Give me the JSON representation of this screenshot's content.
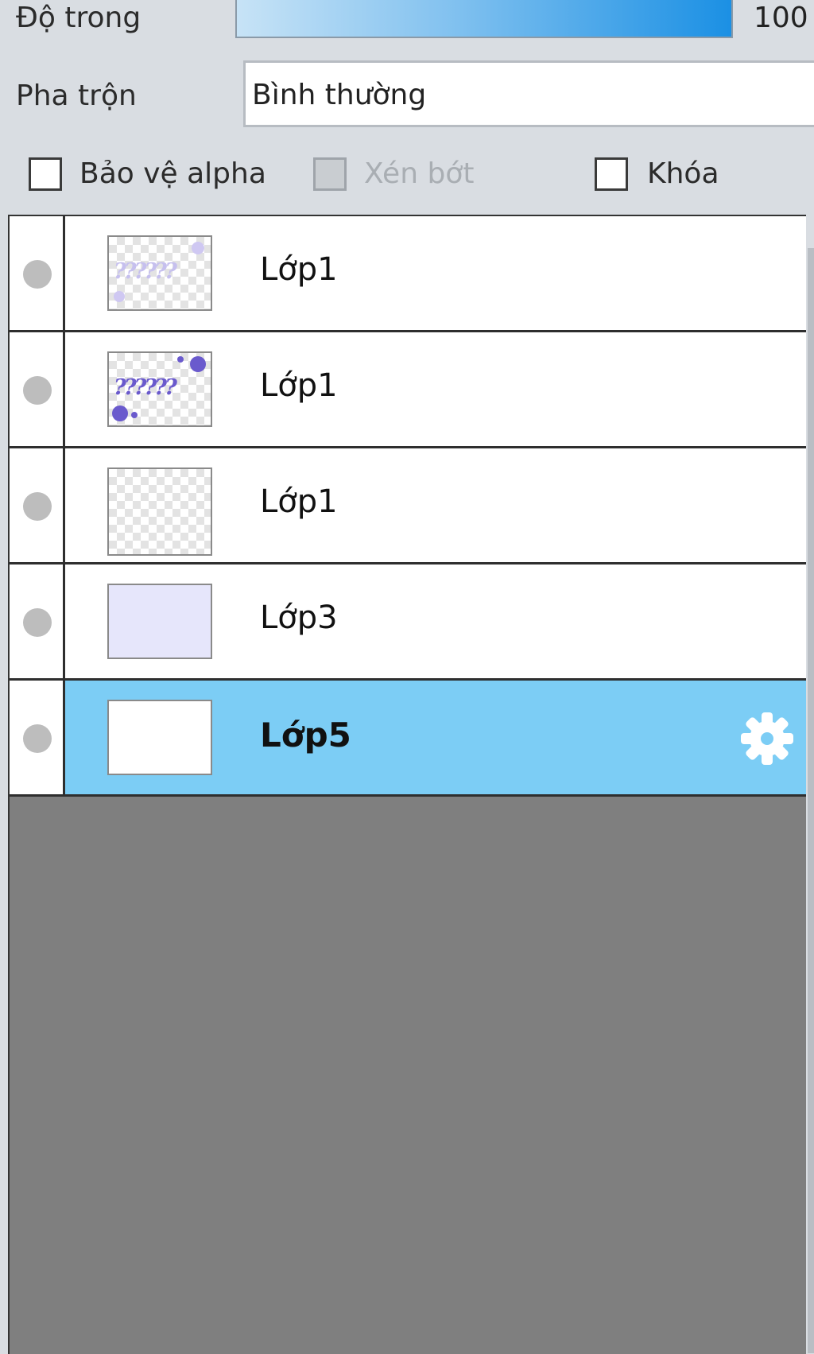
{
  "opacity": {
    "label": "Độ trong",
    "value": "100",
    "level_percent": 100
  },
  "blend": {
    "label": "Pha trộn",
    "value": "Bình thường"
  },
  "options": {
    "protect_alpha": {
      "label": "Bảo vệ alpha",
      "checked": false,
      "enabled": true
    },
    "clipping": {
      "label": "Xén bớt",
      "checked": false,
      "enabled": false
    },
    "lock": {
      "label": "Khóa",
      "checked": false,
      "enabled": true
    }
  },
  "layers": [
    {
      "name": "Lớp1",
      "thumbnail": "light-purple-pattern",
      "selected": false
    },
    {
      "name": "Lớp1",
      "thumbnail": "purple-question-marks",
      "selected": false
    },
    {
      "name": "Lớp1",
      "thumbnail": "transparent",
      "selected": false
    },
    {
      "name": "Lớp3",
      "thumbnail": "lavender-fill",
      "selected": false
    },
    {
      "name": "Lớp5",
      "thumbnail": "white-fill",
      "selected": true,
      "action_icon": "gear-icon"
    }
  ],
  "colors": {
    "selected_row": "#7ccdf5",
    "opacity_gradient_end": "#1b90e4",
    "empty_list": "#7f7f7f",
    "thumb_mark": "#6a5acd"
  }
}
